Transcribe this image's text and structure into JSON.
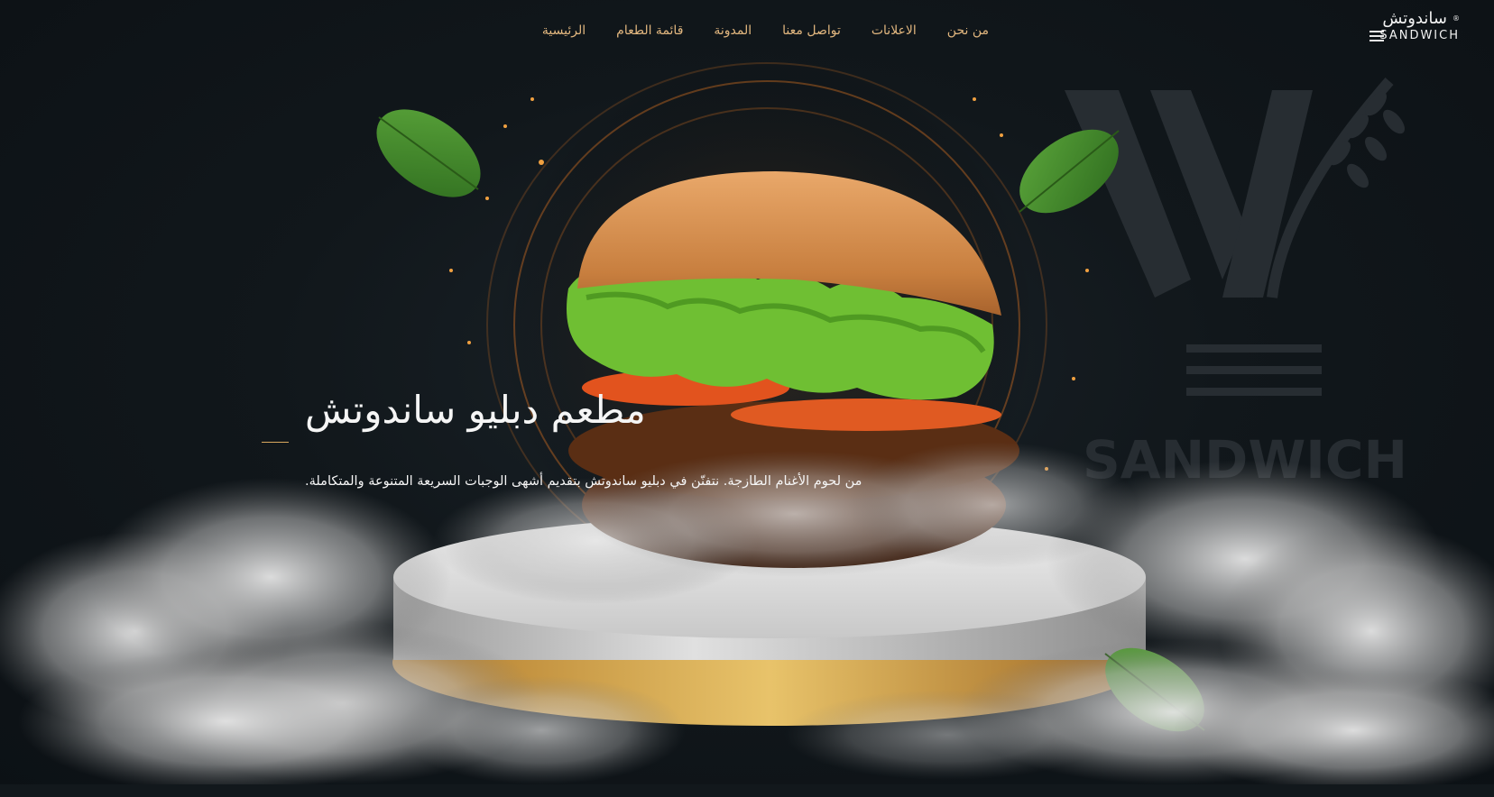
{
  "header": {
    "logo_ar": "ساندوتش",
    "logo_en": "SANDWICH",
    "logo_mark": "®",
    "nav": [
      {
        "label": "الرئيسية"
      },
      {
        "label": "قائمة الطعام"
      },
      {
        "label": "المدونة"
      },
      {
        "label": "تواصل معنا"
      },
      {
        "label": "الاعلانات"
      },
      {
        "label": "من نحن"
      }
    ]
  },
  "watermark": {
    "text": "SANDWICH"
  },
  "hero": {
    "title": "مطعم دبليو ساندوتش",
    "subtitle": "من لحوم الأغنام الطازجة. نتفنّن في دبليو ساندوتش بتقديم أشهى الوجبات السريعة المتنوعة والمتكاملة."
  },
  "colors": {
    "background": "#0f1418",
    "nav_text": "#e2b77f",
    "accent_gold": "#d9a85e",
    "text_light": "#f5f5f5"
  }
}
